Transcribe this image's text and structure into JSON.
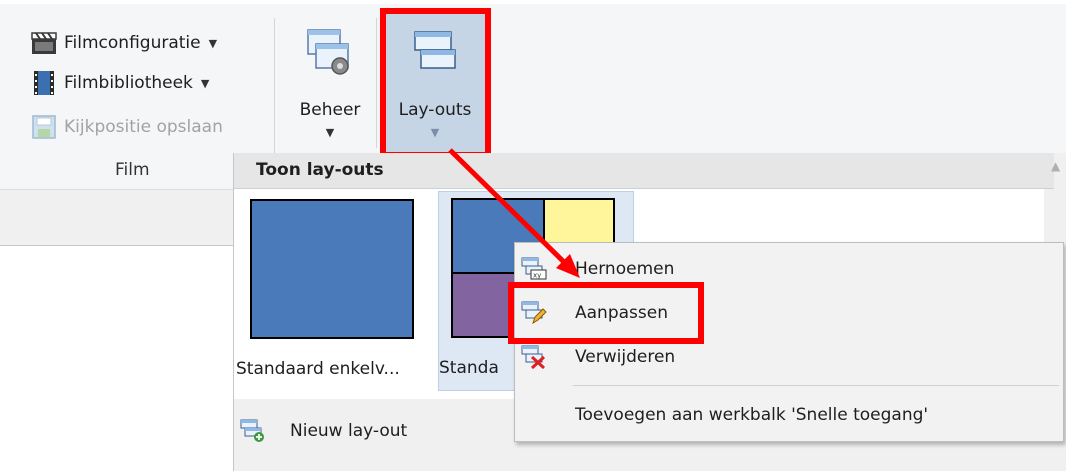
{
  "ribbon": {
    "film_group": {
      "items": [
        {
          "label": "Filmconfiguratie",
          "icon": "clapperboard-icon",
          "has_dropdown": true,
          "enabled": true
        },
        {
          "label": "Filmbibliotheek",
          "icon": "film-strip-icon",
          "has_dropdown": true,
          "enabled": true
        },
        {
          "label": "Kijkpositie opslaan",
          "icon": "save-view-icon",
          "has_dropdown": false,
          "enabled": false
        }
      ],
      "group_label": "Film"
    },
    "beheer_button": {
      "label": "Beheer",
      "icon": "manage-windows-icon"
    },
    "layouts_button": {
      "label": "Lay-outs",
      "icon": "layouts-icon",
      "active": true
    }
  },
  "gallery": {
    "title": "Toon lay-outs",
    "items": [
      {
        "label": "Standaard enkelv...",
        "selected": false
      },
      {
        "label": "Standa",
        "selected": true
      }
    ],
    "new_layout_label": "Nieuw lay-out"
  },
  "context_menu": {
    "items": [
      {
        "label": "Hernoemen",
        "icon": "rename-icon"
      },
      {
        "label": "Aanpassen",
        "icon": "edit-layout-icon",
        "highlighted": true
      },
      {
        "label": "Verwijderen",
        "icon": "delete-layout-icon"
      }
    ],
    "quick_access_label": "Toevoegen aan werkbalk 'Snelle toegang'"
  },
  "colors": {
    "accent_red": "#ff0000",
    "thumb_blue": "#4a7ab9",
    "thumb_yellow": "#fff59a",
    "thumb_purple": "#8264a0",
    "selection_blue": "#c5d5e6"
  }
}
